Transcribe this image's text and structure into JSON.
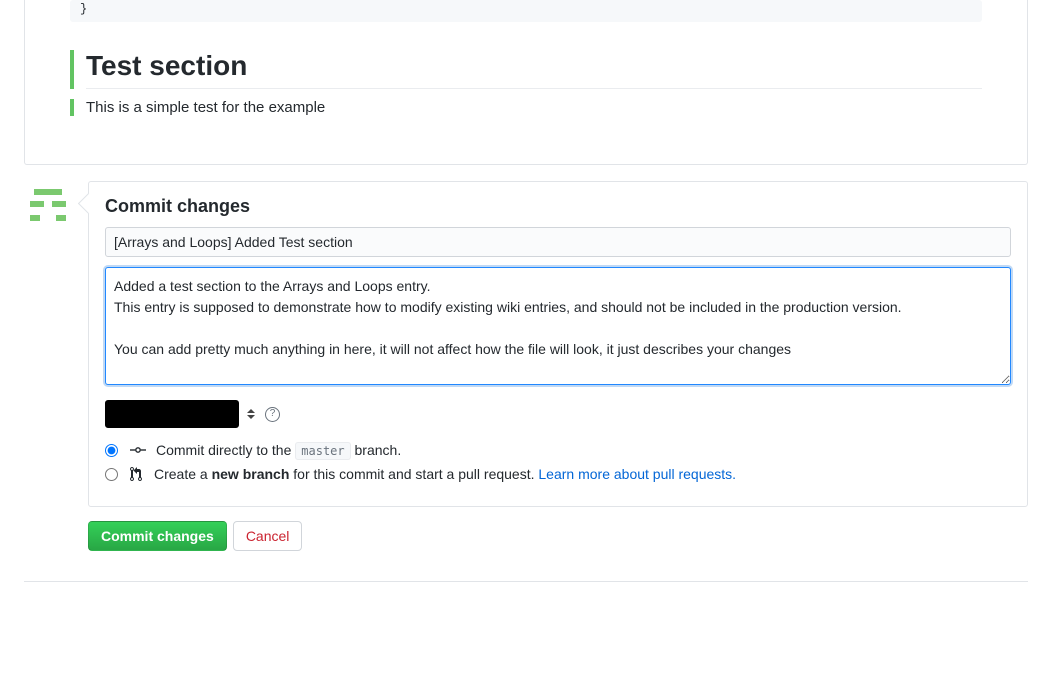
{
  "preview": {
    "code_tail": "}",
    "section_heading": "Test section",
    "section_text": "This is a simple test for the example"
  },
  "commit": {
    "title": "Commit changes",
    "summary_value": "[Arrays and Loops] Added Test section",
    "description_value": "Added a test section to the Arrays and Loops entry.\nThis entry is supposed to demonstrate how to modify existing wiki entries, and should not be included in the production version.\n\nYou can add pretty much anything in here, it will not affect how the file will look, it just describes your changes",
    "help_glyph": "?",
    "direct_prefix": "Commit directly to the ",
    "direct_branch": "master",
    "direct_suffix": " branch.",
    "new_prefix": "Create a ",
    "new_bold": "new branch",
    "new_mid": " for this commit and start a pull request. ",
    "new_link": "Learn more about pull requests.",
    "submit_label": "Commit changes",
    "cancel_label": "Cancel"
  }
}
